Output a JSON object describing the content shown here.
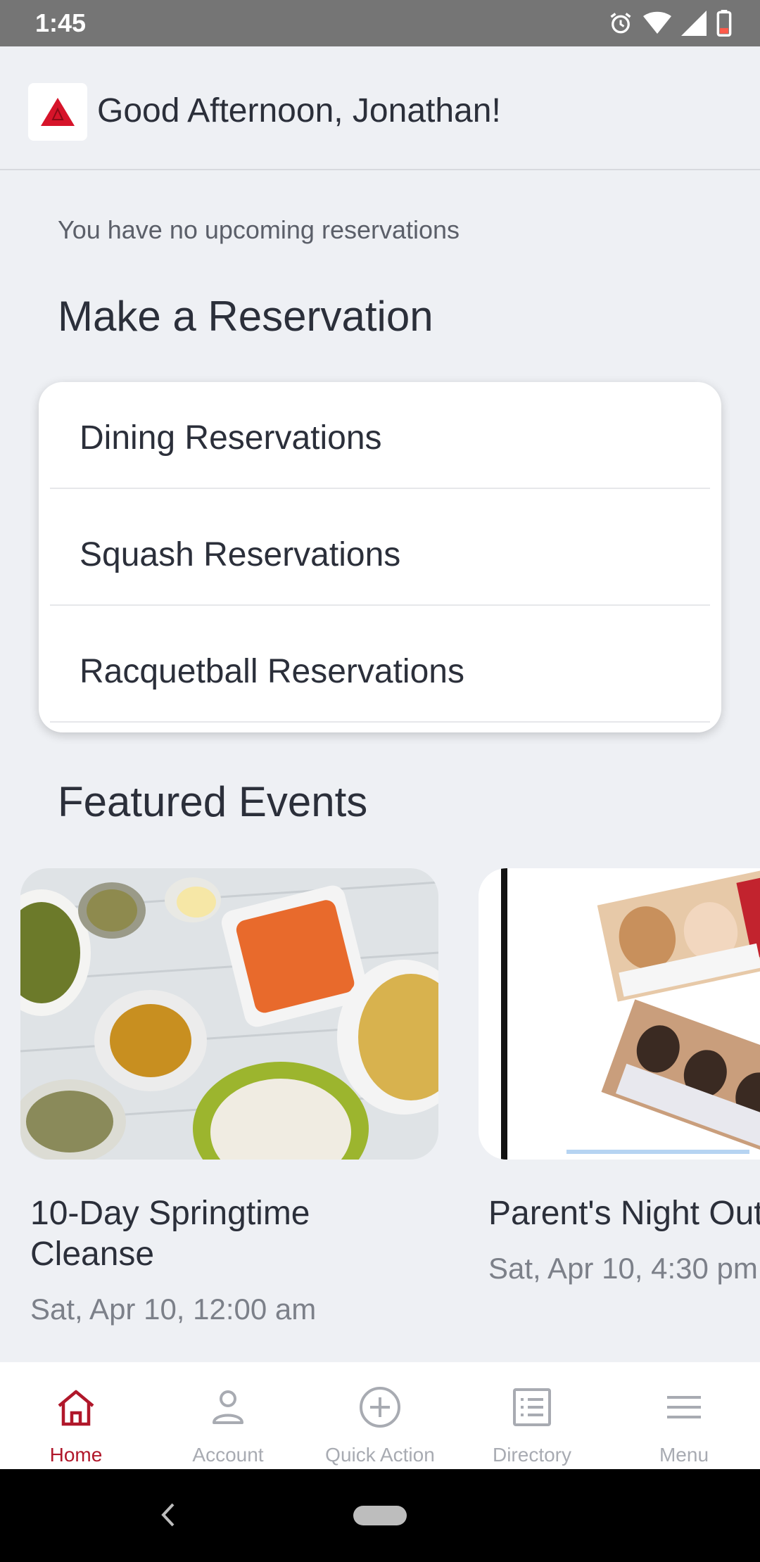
{
  "status_bar": {
    "time": "1:45"
  },
  "header": {
    "greeting": "Good Afternoon, Jonathan!"
  },
  "reservations": {
    "empty_message": "You have no upcoming reservations",
    "section_title": "Make a Reservation",
    "items": [
      {
        "label": "Dining Reservations"
      },
      {
        "label": "Squash Reservations"
      },
      {
        "label": "Racquetball Reservations"
      }
    ]
  },
  "events": {
    "section_title": "Featured Events",
    "items": [
      {
        "title": "10-Day Springtime Cleanse",
        "date": "Sat, Apr 10, 12:00 am"
      },
      {
        "title": "Parent's Night Out",
        "date": "Sat, Apr 10, 4:30 pm"
      }
    ]
  },
  "bottom_nav": {
    "items": [
      {
        "label": "Home",
        "icon": "home-icon",
        "active": true
      },
      {
        "label": "Account",
        "icon": "person-icon",
        "active": false
      },
      {
        "label": "Quick Action",
        "icon": "plus-circle-icon",
        "active": false
      },
      {
        "label": "Directory",
        "icon": "list-icon",
        "active": false
      },
      {
        "label": "Menu",
        "icon": "hamburger-icon",
        "active": false
      }
    ]
  },
  "colors": {
    "accent": "#b0172a",
    "logo": "#d6142a",
    "background": "#eef0f4"
  }
}
